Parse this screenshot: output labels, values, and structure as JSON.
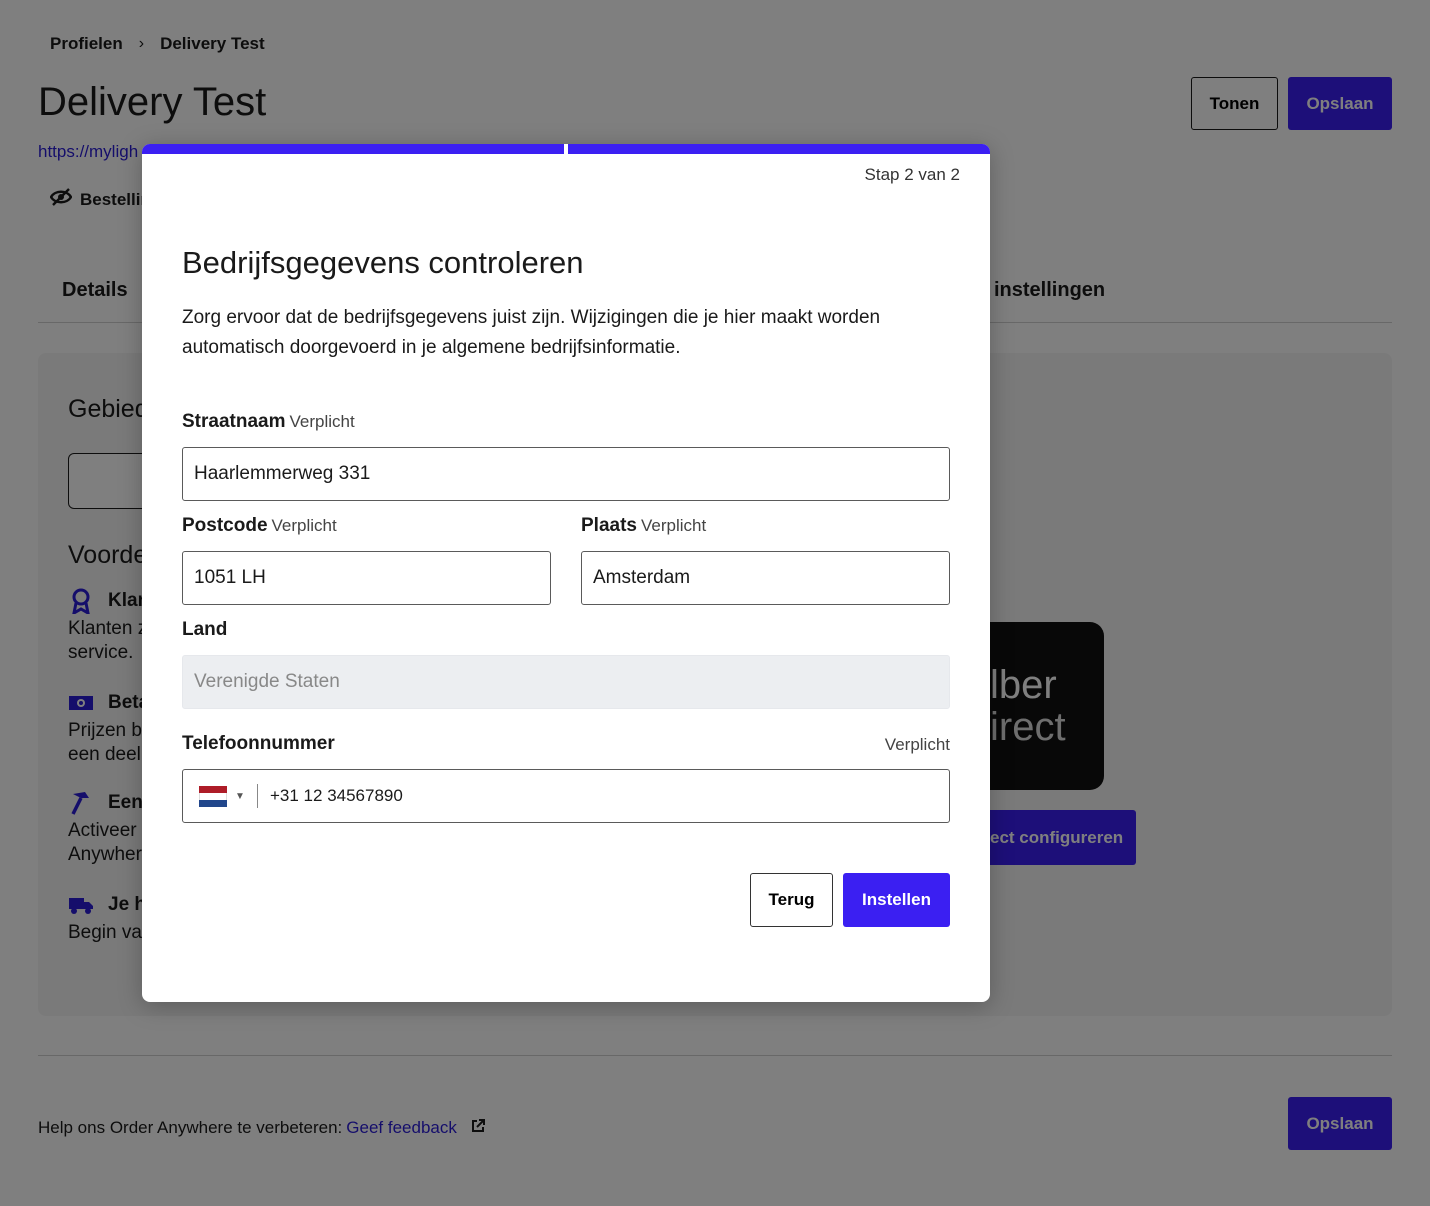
{
  "breadcrumb": {
    "parent": "Profielen",
    "separator": "›",
    "current": "Delivery Test"
  },
  "page": {
    "title": "Delivery Test",
    "url_partial": "https://myligh",
    "orders_partial": "Bestellir",
    "tonen_label": "Tonen",
    "opslaan_label": "Opslaan"
  },
  "tabs": {
    "details": "Details",
    "settings_partial": "instellingen"
  },
  "panel": {
    "title_partial": "Gebied",
    "sub_partial": "Voorde",
    "advantages": [
      {
        "icon": "award-icon",
        "title_partial": "Klan",
        "text_partial_1": "Klanten z",
        "text_partial_2": "service."
      },
      {
        "icon": "cash-icon",
        "title_partial": "Beta",
        "text_partial_1": "Prijzen b",
        "text_partial_2": "een deel"
      },
      {
        "icon": "hammer-icon",
        "title_partial": "Een",
        "text_partial_1": "Activeer",
        "text_partial_2": "Anywher"
      },
      {
        "icon": "truck-icon",
        "title_partial": "Je h",
        "text_partial_1": "Begin va",
        "text_partial_2": ""
      }
    ],
    "uber_tile_line1": "lber",
    "uber_tile_line2": "irect",
    "uber_button_partial": "ect configureren"
  },
  "footer": {
    "text": "Help ons Order Anywhere te verbeteren:",
    "link": "Geef feedback",
    "opslaan_label": "Opslaan"
  },
  "modal": {
    "step": "Stap 2 van 2",
    "title": "Bedrijfsgegevens controleren",
    "description": "Zorg ervoor dat de bedrijfsgegevens juist zijn. Wijzigingen die je hier maakt worden automatisch doorgevoerd in je algemene bedrijfsinformatie.",
    "required_text": "Verplicht",
    "street": {
      "label": "Straatnaam",
      "value": "Haarlemmerweg 331"
    },
    "postcode": {
      "label": "Postcode",
      "value": "1051 LH"
    },
    "city": {
      "label": "Plaats",
      "value": "Amsterdam"
    },
    "country": {
      "label": "Land",
      "value": "Verenigde Staten"
    },
    "phone": {
      "label": "Telefoonnummer",
      "value": "+31 12 34567890",
      "country_flag": "NL"
    },
    "back_label": "Terug",
    "submit_label": "Instellen"
  },
  "colors": {
    "accent": "#3b1ff2",
    "link": "#2b1dd6",
    "overlay": "rgba(0,0,0,0.5)"
  }
}
